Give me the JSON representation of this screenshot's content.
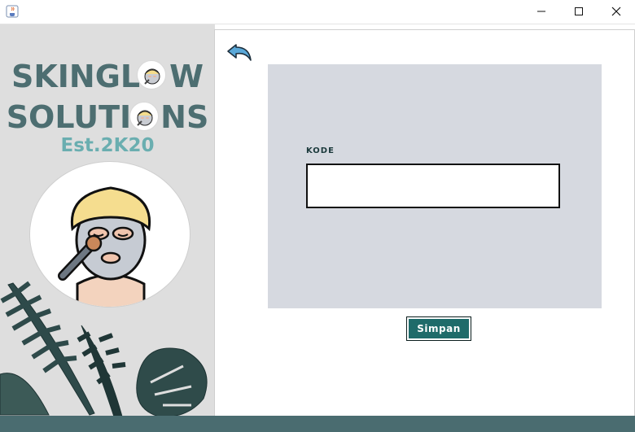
{
  "window": {
    "app_icon": "java-cup-icon",
    "controls": [
      "minimize-icon",
      "maximize-icon",
      "close-icon"
    ]
  },
  "brand": {
    "line1_a": "SKINGL",
    "line1_b": "W",
    "line2_a": "SOLUTI",
    "line2_b": "NS",
    "est": "Est.2K20",
    "colors": {
      "primary": "#4d6e71",
      "secondary": "#6aaeb0"
    }
  },
  "form": {
    "back_icon": "undo-arrow-icon",
    "kode_label": "KODE",
    "kode_value": "",
    "save_label": "Simpan",
    "accent": "#1f6b6a"
  }
}
